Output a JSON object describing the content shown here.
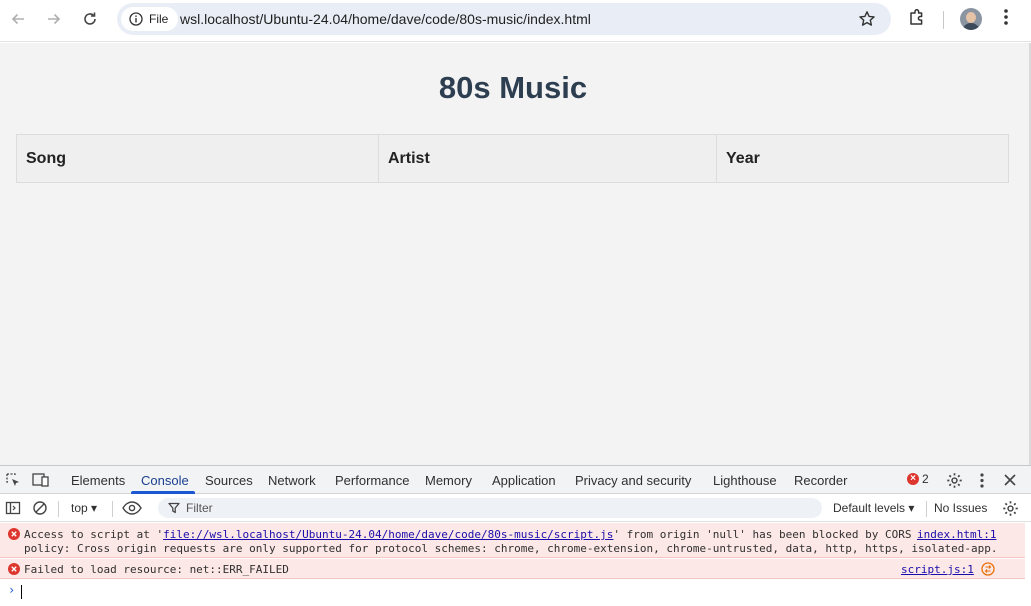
{
  "browser": {
    "scheme_chip": "File",
    "url": "wsl.localhost/Ubuntu-24.04/home/dave/code/80s-music/index.html"
  },
  "page": {
    "title": "80s Music",
    "table_headers": [
      "Song",
      "Artist",
      "Year"
    ]
  },
  "devtools": {
    "tabs": [
      "Elements",
      "Console",
      "Sources",
      "Network",
      "Performance",
      "Memory",
      "Application",
      "Privacy and security",
      "Lighthouse",
      "Recorder"
    ],
    "active_tab": "Console",
    "error_count": "2",
    "context": "top",
    "filter_placeholder": "Filter",
    "levels": "Default levels",
    "issues": "No Issues",
    "messages": [
      {
        "prefix": "Access to script at '",
        "link": "file://wsl.localhost/Ubuntu-24.04/home/dave/code/80s-music/script.js",
        "suffix": "' from origin 'null' has been blocked by CORS",
        "line2": "policy: Cross origin requests are only supported for protocol schemes: chrome, chrome-extension, chrome-untrusted, data, http, https, isolated-app.",
        "source": "index.html:1"
      },
      {
        "text": "Failed to load resource: net::ERR_FAILED",
        "source": "script.js:1"
      }
    ]
  }
}
